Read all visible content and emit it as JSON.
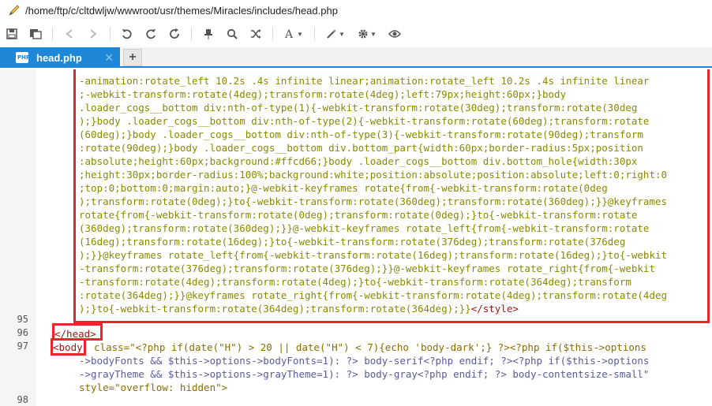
{
  "window": {
    "path": "/home/ftp/c/cltdwljw/wwwroot/usr/themes/Miracles/includes/head.php"
  },
  "toolbar": {
    "buttons": [
      {
        "name": "save-icon"
      },
      {
        "name": "save-all-icon"
      },
      {
        "name": "back-icon"
      },
      {
        "name": "forward-icon"
      },
      {
        "name": "undo-icon"
      },
      {
        "name": "redo-icon"
      },
      {
        "name": "refresh-icon"
      },
      {
        "name": "pin-icon"
      },
      {
        "name": "search-icon"
      },
      {
        "name": "shuffle-icon"
      },
      {
        "name": "font-icon"
      },
      {
        "name": "magic-wand-icon"
      },
      {
        "name": "gear-icon"
      },
      {
        "name": "eye-icon"
      }
    ]
  },
  "tabs": {
    "active_label": "head.php",
    "close_glyph": "✕",
    "add_glyph": "+"
  },
  "editor": {
    "line_numbers": [
      "95",
      "96",
      "97",
      "98"
    ],
    "css_lines": [
      "-animation:rotate_left 10.2s .4s infinite linear;animation:rotate_left 10.2s .4s infinite linear",
      ";-webkit-transform:rotate(4deg);transform:rotate(4deg);left:79px;height:60px;}body",
      ".loader_cogs__bottom div:nth-of-type(1){-webkit-transform:rotate(30deg);transform:rotate(30deg",
      ");}body .loader_cogs__bottom div:nth-of-type(2){-webkit-transform:rotate(60deg);transform:rotate",
      "(60deg);}body .loader_cogs__bottom div:nth-of-type(3){-webkit-transform:rotate(90deg);transform",
      ":rotate(90deg);}body .loader_cogs__bottom div.bottom_part{width:60px;border-radius:5px;position",
      ":absolute;height:60px;background:#ffcd66;}body .loader_cogs__bottom div.bottom_hole{width:30px",
      ";height:30px;border-radius:100%;background:white;position:absolute;position:absolute;left:0;right:0",
      ";top:0;bottom:0;margin:auto;}@-webkit-keyframes rotate{from{-webkit-transform:rotate(0deg",
      ");transform:rotate(0deg);}to{-webkit-transform:rotate(360deg);transform:rotate(360deg);}}@keyframes",
      "rotate{from{-webkit-transform:rotate(0deg);transform:rotate(0deg);}to{-webkit-transform:rotate",
      "(360deg);transform:rotate(360deg);}}@-webkit-keyframes rotate_left{from{-webkit-transform:rotate",
      "(16deg);transform:rotate(16deg);}to{-webkit-transform:rotate(376deg);transform:rotate(376deg",
      ");}}@keyframes rotate_left{from{-webkit-transform:rotate(16deg);transform:rotate(16deg);}to{-webkit",
      "-transform:rotate(376deg);transform:rotate(376deg);}}@-webkit-keyframes rotate_right{from{-webkit",
      "-transform:rotate(4deg);transform:rotate(4deg);}to{-webkit-transform:rotate(364deg);transform",
      ":rotate(364deg);}}@keyframes rotate_right{from{-webkit-transform:rotate(4deg);transform:rotate(4deg",
      ");}to{-webkit-transform:rotate(364deg);transform:rotate(364deg);}}"
    ],
    "style_close_tag": "</style>",
    "head_close_tag": "</head>",
    "body_tag": "<body",
    "line97_part1": "  class=\"<?php if(date(\"H\") > 20 || date(\"H\") < 7){echo 'body-dark';} ?><?php if($this->options",
    "line97_part2": "->bodyFonts && $this->options->bodyFonts=1): ?> body-serif<?php endif; ?><?php if($this->options",
    "line97_part3": "->grayTheme && $this->options->grayTheme=1): ?> body-gray<?php endif; ?> body-contentsize-small\"",
    "line97_part4": "style=\"overflow: hidden\">"
  },
  "colors": {
    "accent": "#1e87d8",
    "highlight": "#e8262c"
  }
}
